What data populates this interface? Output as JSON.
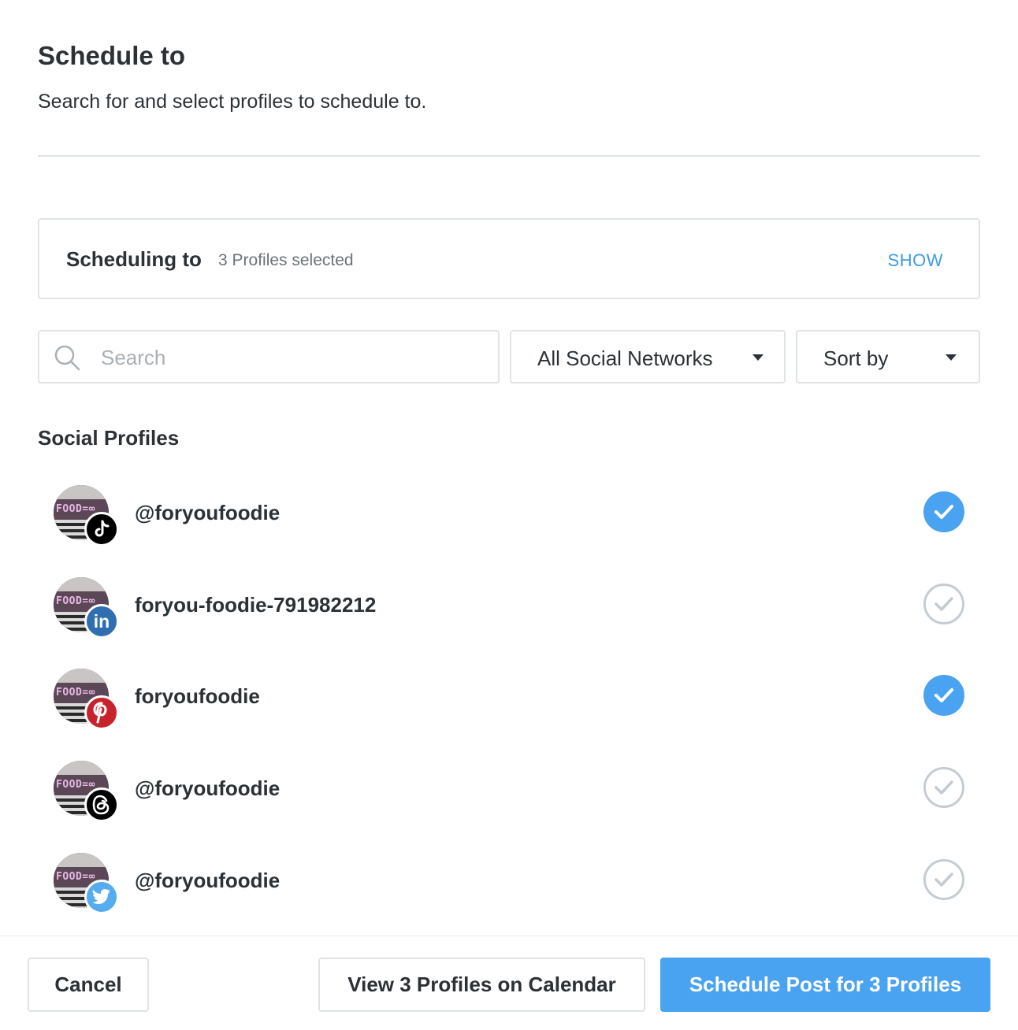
{
  "header": {
    "title": "Schedule to",
    "subtitle": "Search for and select profiles to schedule to."
  },
  "scheduling": {
    "label": "Scheduling to",
    "count_text": "3 Profiles selected",
    "show_label": "SHOW"
  },
  "filters": {
    "search_placeholder": "Search",
    "search_value": "",
    "network_selected": "All Social Networks",
    "sort_selected": "Sort by"
  },
  "section": {
    "title": "Social Profiles"
  },
  "profiles": [
    {
      "name": "@foryoufoodie",
      "network": "tiktok",
      "network_icon": "tiktok-icon",
      "selected": true
    },
    {
      "name": "foryou-foodie-791982212",
      "network": "linkedin",
      "network_icon": "linkedin-icon",
      "selected": false
    },
    {
      "name": "foryoufoodie",
      "network": "pinterest",
      "network_icon": "pinterest-icon",
      "selected": true
    },
    {
      "name": "@foryoufoodie",
      "network": "threads",
      "network_icon": "threads-icon",
      "selected": false
    },
    {
      "name": "@foryoufoodie",
      "network": "twitter",
      "network_icon": "twitter-icon",
      "selected": false
    }
  ],
  "avatar": {
    "text": "FOOD=∞"
  },
  "footer": {
    "cancel_label": "Cancel",
    "view_label": "View 3 Profiles on Calendar",
    "schedule_label": "Schedule Post for 3 Profiles"
  },
  "colors": {
    "accent": "#4aa3f0",
    "link": "#3d9be9",
    "tiktok": "#000000",
    "linkedin": "#2f6fb0",
    "pinterest": "#c8232c",
    "threads": "#000000",
    "twitter": "#55acee"
  }
}
